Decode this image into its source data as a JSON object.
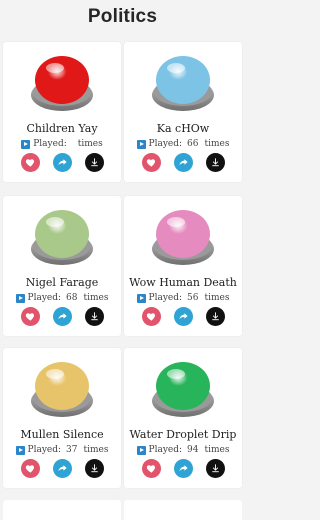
{
  "header": {
    "title": "Politics"
  },
  "played_label": "Played:",
  "times_label": "times",
  "cards": [
    {
      "title": "Children Yay",
      "count": "",
      "color": "red"
    },
    {
      "title": "Ka cHOw",
      "count": "66",
      "color": "blue"
    },
    {
      "title": "Nigel Farage",
      "count": "68",
      "color": "green-light"
    },
    {
      "title": "Wow Human Death",
      "count": "56",
      "color": "pink"
    },
    {
      "title": "Mullen Silence",
      "count": "37",
      "color": "yellow"
    },
    {
      "title": "Water Droplet Drip",
      "count": "94",
      "color": "green"
    }
  ],
  "colors": {
    "red": "#e01818",
    "blue": "#7cc3e6",
    "green-light": "#a9c98a",
    "pink": "#e58bbf",
    "yellow": "#e7c46a",
    "green": "#27b45b",
    "fav": "#e2546c",
    "share": "#2fa3d4",
    "download": "#111111"
  },
  "icons": {
    "favorite": "heart-icon",
    "share": "share-arrow-icon",
    "download": "download-icon",
    "played": "play-icon"
  }
}
